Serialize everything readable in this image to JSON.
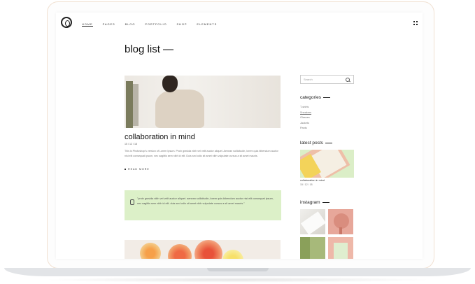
{
  "nav": {
    "items": [
      "HOME",
      "PAGES",
      "BLOG",
      "PORTFOLIO",
      "SHOP",
      "ELEMENTS"
    ]
  },
  "page": {
    "title": "blog list —"
  },
  "post": {
    "title": "collaboration in mind",
    "date": "15 / 12 / 18",
    "excerpt": "This is Photoshop's version of Lorem Ipsum. Proin gravida nibh vel velit auctor aliquet. Aenean sollicitudin, lorem quis bibendum auctor nisi elit consequat ipsum, nec sagittis sem nibh id elit. Duis sed odio sit amet nibh vulputate cursus a sit amet mauris.",
    "read_more": "READ MORE"
  },
  "quote": {
    "text": "\"proin gravida nibh vel velit auctor aliquet. aenean sollicitudin, lorem quis bibendum auctor nisi elit consequat ipsum, nec sagittis sem nibh id elit. duis sed odio sit amet nibh vulputate cursus a sit amet mauris.\""
  },
  "sidebar": {
    "search_placeholder": "Search",
    "categories_title": "categories",
    "categories": [
      "T-shirts",
      "Sneakers",
      "Glasses",
      "Jackets",
      "Pants"
    ],
    "latest_title": "latest posts",
    "latest_caption": "collaboration in mind",
    "latest_date": "15 / 12 / 18",
    "instagram_title": "instagram"
  },
  "colors": {
    "quote_bg": "#dcf0c8",
    "latest_bg": "#dbeec7"
  }
}
